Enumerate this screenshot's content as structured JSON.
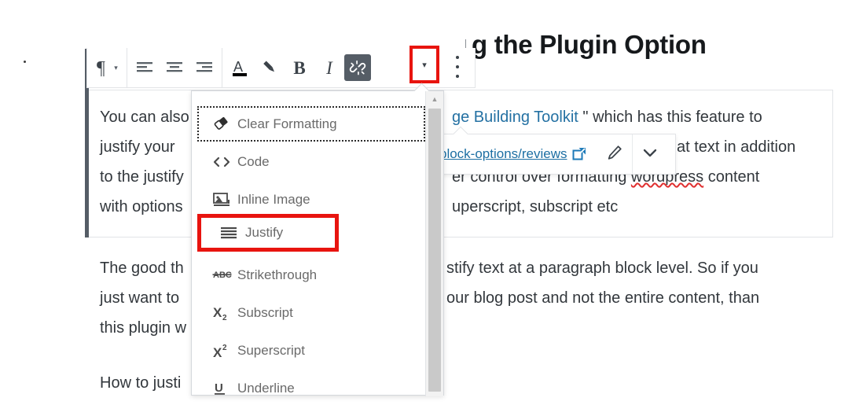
{
  "document": {
    "heading_visible": "g the Plugin Option",
    "paragraph_one": {
      "lines": [
        {
          "left_text": "You can also ",
          "hidden_mid": "",
          "link_text": "ge Building Toolkit",
          "right_text": " \" which has this feature to"
        },
        {
          "left_text": "justify your ",
          "right_text": "at text in addition"
        },
        {
          "left_text": "to the justify",
          "right_text": "er control over formatting ",
          "misspelled": "wordpress",
          "right_tail": " content"
        },
        {
          "left_text": "with options",
          "right_text": "uperscript, subscript etc"
        }
      ]
    },
    "paragraph_two": {
      "lines": [
        {
          "left_text": "The good th",
          "right_text": "stify text at a paragraph block level. So if you"
        },
        {
          "left_text": "just want to",
          "right_text": "our blog post and not the entire content, than"
        },
        {
          "left_text": "this plugin w",
          "right_text": ""
        }
      ]
    },
    "paragraph_three": {
      "left_text": "How to justi"
    }
  },
  "toolbar": {
    "paragraph_type_icon": "paragraph-icon",
    "paragraph_type_caret": "▾",
    "align_left_icon": "align-left-icon",
    "align_center_icon": "align-center-icon",
    "align_right_icon": "align-right-icon",
    "text_color_label": "A",
    "highlight_icon": "highlighter-icon",
    "bold_label": "B",
    "italic_label": "I",
    "unlink_icon": "unlink-icon",
    "more_caret": "▾",
    "kebab_icon": "more-options-icon"
  },
  "dropdown": {
    "items": [
      {
        "label": "Clear Formatting",
        "icon": "eraser-icon",
        "focused": true
      },
      {
        "label": "Code",
        "icon": "code-icon",
        "focused": false
      },
      {
        "label": "Inline Image",
        "icon": "inline-image-icon",
        "focused": false
      },
      {
        "label": "Justify",
        "icon": "justify-icon",
        "focused": false,
        "highlighted": true
      },
      {
        "label": "Strikethrough",
        "icon": "strikethrough-icon",
        "focused": false
      },
      {
        "label": "Subscript",
        "icon": "subscript-icon",
        "focused": false
      },
      {
        "label": "Superscript",
        "icon": "superscript-icon",
        "focused": false
      },
      {
        "label": "Underline",
        "icon": "underline-icon",
        "focused": false
      }
    ],
    "scroll_up_glyph": "▲"
  },
  "link_popup": {
    "url_text": "block-options/reviews",
    "external_icon": "external-link-icon",
    "edit_icon": "pencil-icon",
    "expand_icon": "chevron-down-icon"
  },
  "colors": {
    "highlight_red": "#e8140f",
    "link_blue": "#2471a3",
    "toolbar_active_bg": "#555d66",
    "border_gray": "#e2e4e7",
    "text_gray": "#32373c"
  }
}
